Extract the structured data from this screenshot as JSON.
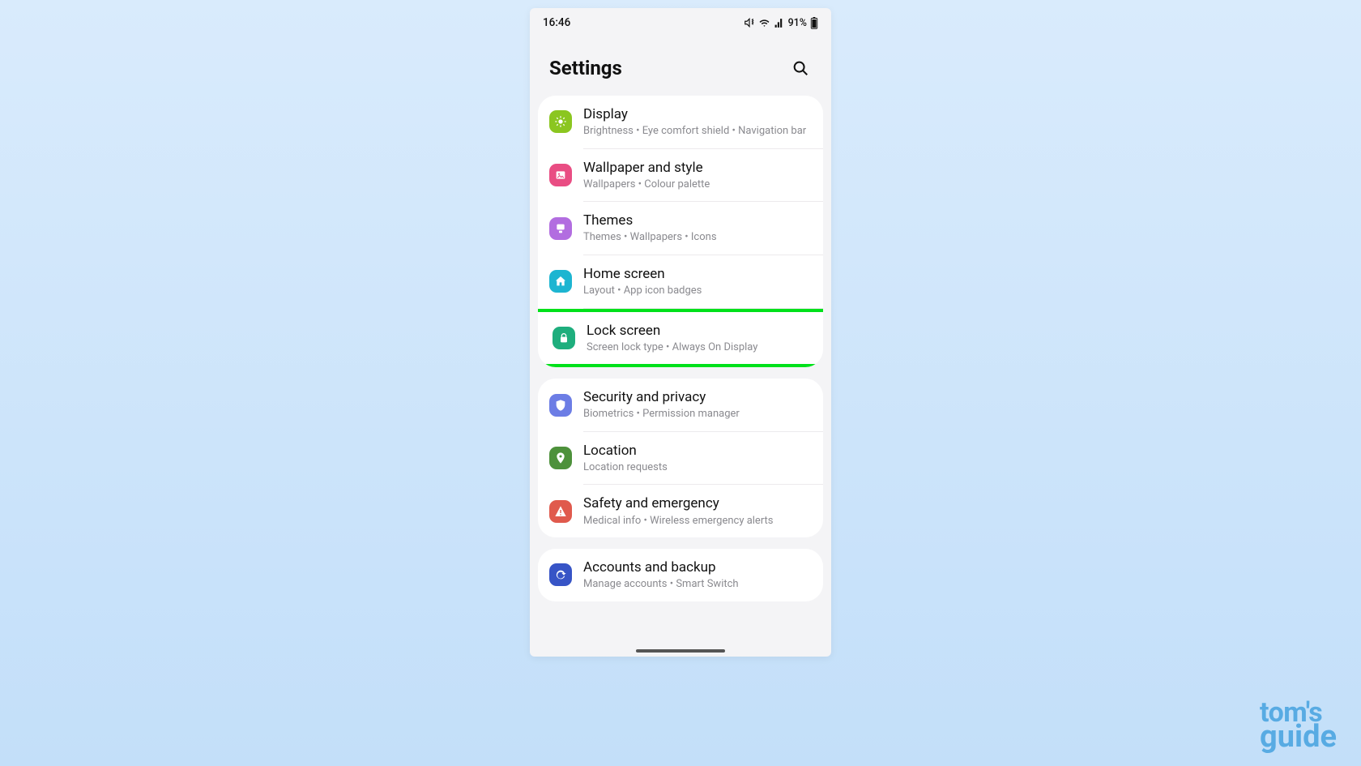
{
  "status": {
    "time": "16:46",
    "battery_pct": "91%"
  },
  "header": {
    "title": "Settings"
  },
  "groups": [
    {
      "items": [
        {
          "id": "display",
          "title": "Display",
          "sub": "Brightness  •  Eye comfort shield  •  Navigation bar",
          "icon": "sun",
          "color": "#8bc620"
        },
        {
          "id": "wallpaper",
          "title": "Wallpaper and style",
          "sub": "Wallpapers  •  Colour palette",
          "icon": "image",
          "color": "#e94d83"
        },
        {
          "id": "themes",
          "title": "Themes",
          "sub": "Themes  •  Wallpapers  •  Icons",
          "icon": "themes",
          "color": "#b26de0"
        },
        {
          "id": "home",
          "title": "Home screen",
          "sub": "Layout  •  App icon badges",
          "icon": "home",
          "color": "#1db5d1"
        },
        {
          "id": "lock",
          "title": "Lock screen",
          "sub": "Screen lock type  •  Always On Display",
          "icon": "lock",
          "color": "#1eae7d",
          "highlighted": true
        }
      ]
    },
    {
      "items": [
        {
          "id": "security",
          "title": "Security and privacy",
          "sub": "Biometrics  •  Permission manager",
          "icon": "shield",
          "color": "#6c7de5"
        },
        {
          "id": "location",
          "title": "Location",
          "sub": "Location requests",
          "icon": "pin",
          "color": "#4d913b"
        },
        {
          "id": "safety",
          "title": "Safety and emergency",
          "sub": "Medical info  •  Wireless emergency alerts",
          "icon": "alert",
          "color": "#e05a4d"
        }
      ]
    },
    {
      "items": [
        {
          "id": "accounts",
          "title": "Accounts and backup",
          "sub": "Manage accounts  •  Smart Switch",
          "icon": "sync",
          "color": "#3754c6"
        }
      ]
    }
  ],
  "watermark": {
    "line1": "tom's",
    "line2": "guide"
  }
}
